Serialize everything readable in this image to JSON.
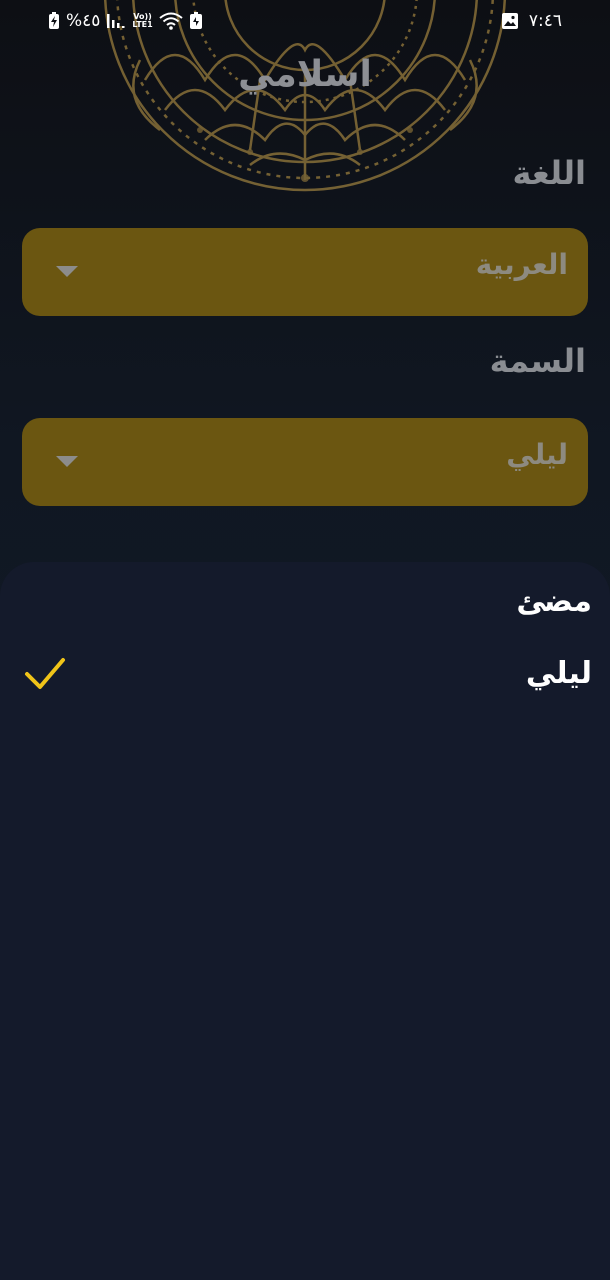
{
  "status_bar": {
    "time": "٧:٤٦",
    "battery_percent": "%٤٥",
    "volte_top": "Vo))",
    "volte_bottom": "LTE1",
    "icons": [
      "battery-charging-icon",
      "signal-icon",
      "volte-icon",
      "wifi-icon",
      "battery-saver-icon",
      "gallery-notification-icon"
    ]
  },
  "header": {
    "app_title": "اسلامي"
  },
  "settings": {
    "language_label": "اللغة",
    "language_value": "العربية",
    "theme_label": "السمة",
    "theme_value": "ليلي"
  },
  "theme_sheet": {
    "options": [
      {
        "label": "مضئ",
        "selected": false
      },
      {
        "label": "ليلي",
        "selected": true
      }
    ]
  },
  "colors": {
    "background": "#101722",
    "dropdown": "#6b5611",
    "sheet": "#141a2b",
    "accent_check": "#f0c419",
    "mandala": "#c9a24a"
  }
}
